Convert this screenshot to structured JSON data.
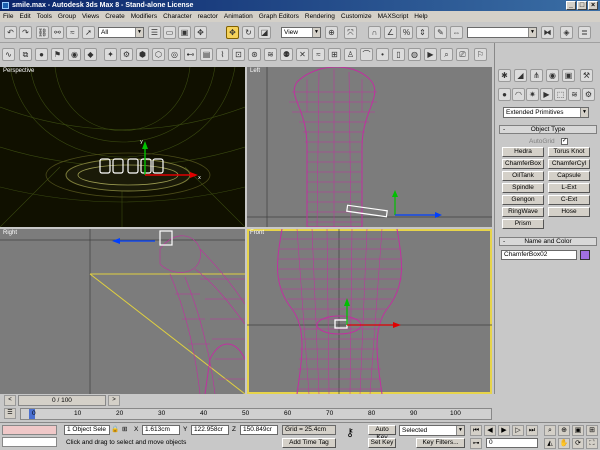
{
  "window": {
    "title": "smile.max - Autodesk 3ds Max 8 - Stand-alone License",
    "min": "_",
    "max": "□",
    "close": "×"
  },
  "menu": [
    "File",
    "Edit",
    "Tools",
    "Group",
    "Views",
    "Create",
    "Modifiers",
    "Character",
    "reactor",
    "Animation",
    "Graph Editors",
    "Rendering",
    "Customize",
    "MAXScript",
    "Help"
  ],
  "toolbar": {
    "selection_filter": "All",
    "ref_coord": "View",
    "named_selection": ""
  },
  "viewports": {
    "perspective": "Perspective",
    "left": "Left",
    "right": "Right",
    "front": "Front"
  },
  "command_panel": {
    "category": "Extended Primitives",
    "rollout_object_type": "Object Type",
    "autogrid": "AutoGrid",
    "buttons": [
      "Hedra",
      "Torus Knot",
      "ChamferBox",
      "ChamferCyl",
      "OilTank",
      "Capsule",
      "Spindle",
      "L-Ext",
      "Gengon",
      "C-Ext",
      "RingWave",
      "Hose",
      "Prism"
    ],
    "rollout_name_color": "Name and Color",
    "object_name": "ChamferBox02",
    "object_color": "#a070e0"
  },
  "timeline": {
    "frame_label": "0 / 100",
    "ticks": [
      "0",
      "10",
      "20",
      "30",
      "40",
      "50",
      "60",
      "70",
      "80",
      "90",
      "100"
    ]
  },
  "status": {
    "selection": "1 Object Sele",
    "x": "1.613cm",
    "y": "122.958cr",
    "z": "150.849cr",
    "grid": "Grid = 25.4cm",
    "prompt": "Click and drag to select and move objects",
    "add_time_tag": "Add Time Tag",
    "auto_key": "Auto Key",
    "auto_key_mode": "Selected",
    "set_key": "Set Key",
    "key_filters": "Key Filters...",
    "current_frame": "0"
  },
  "colors": {
    "selection_wire": "#d010b0",
    "grid_axis": "#000000",
    "active_border": "#e7d44a"
  }
}
